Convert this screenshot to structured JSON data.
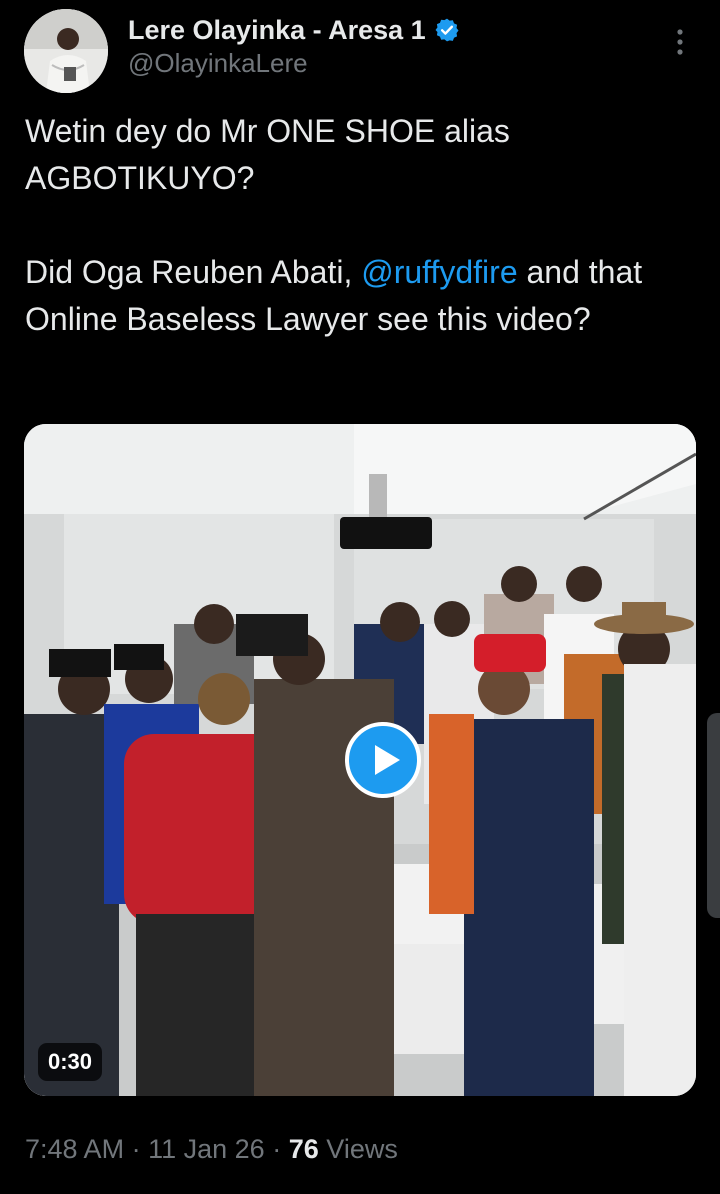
{
  "author": {
    "display_name": "Lere Olayinka - Aresa 1",
    "handle": "@OlayinkaLere",
    "verified": true
  },
  "tweet": {
    "line1": "Wetin dey do Mr ONE SHOE alias AGBOTIKUYO?",
    "line2_before": "Did Oga Reuben Abati, ",
    "mention": "@ruffydfire",
    "line2_after": " and that Online Baseless Lawyer see this video?"
  },
  "media": {
    "type": "video",
    "duration": "0:30",
    "play_icon": "play-icon"
  },
  "meta": {
    "time": "7:48 AM",
    "separator": "·",
    "date": "11 Jan 26",
    "views_count": "76",
    "views_label": "Views"
  },
  "icons": {
    "verified": "verified-badge-icon",
    "more": "more-options-icon"
  },
  "colors": {
    "background": "#000000",
    "text": "#e7e9ea",
    "secondary": "#71767b",
    "accent": "#1d9bf0"
  }
}
